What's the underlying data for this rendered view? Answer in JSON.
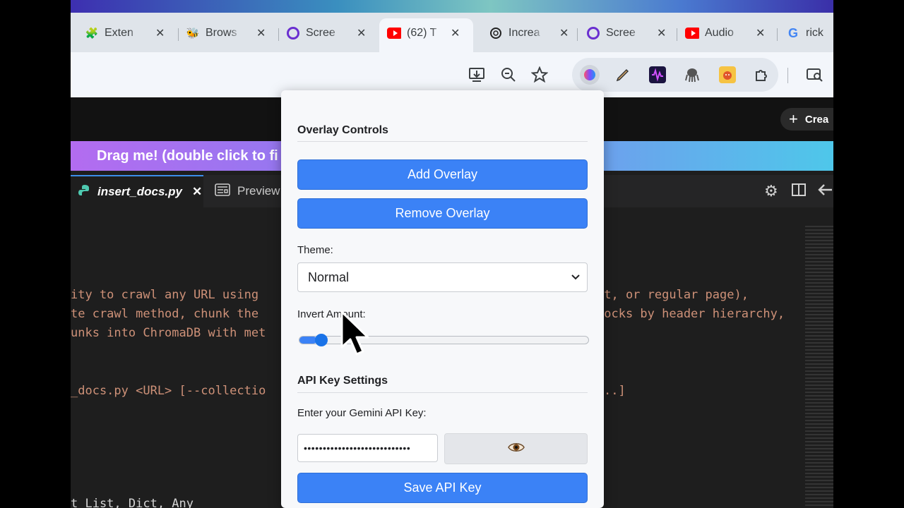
{
  "browser": {
    "tabs": [
      {
        "title": "Exten",
        "icon": "puzzle-icon"
      },
      {
        "title": "Brows",
        "icon": "bee-icon"
      },
      {
        "title": "Scree",
        "icon": "circle-icon"
      },
      {
        "title": "(62) T",
        "icon": "youtube-icon",
        "active": true
      },
      {
        "title": "Increa",
        "icon": "openai-icon"
      },
      {
        "title": "Scree",
        "icon": "circle-icon"
      },
      {
        "title": "Audio",
        "icon": "youtube-icon"
      },
      {
        "title": "rick",
        "icon": "google-icon"
      }
    ],
    "close_glyph": "✕",
    "toolbar_icons": [
      "install-icon",
      "zoom-icon",
      "bookmark-star-icon"
    ],
    "extension_icons": [
      "color-picker-icon",
      "pencil-icon",
      "waveform-icon",
      "octopus-icon",
      "dog-icon",
      "extensions-puzzle-icon"
    ],
    "side_panel_icon": "tab-search-icon"
  },
  "page": {
    "create_label": "Crea",
    "drag_banner": "Drag me! (double click to fi",
    "editor_tabs": [
      {
        "label": "insert_docs.py",
        "close": "✕"
      },
      {
        "label": "Preview"
      }
    ],
    "code_lines": [
      {
        "left": "ity to crawl any URL using",
        "right": "xt, or regular page),"
      },
      {
        "left": "te crawl method, chunk the",
        "right": "locks by header hierarchy,"
      },
      {
        "left": "unks into ChromaDB with met",
        "right": ""
      },
      {
        "left": "_docs.py <URL> [--collectio",
        "right": "..]"
      },
      {
        "left": "t List, Dict, Any",
        "right": ""
      }
    ]
  },
  "popup": {
    "overlay_title": "Overlay Controls",
    "add_overlay": "Add Overlay",
    "remove_overlay": "Remove Overlay",
    "theme_label": "Theme:",
    "theme_value": "Normal",
    "invert_label": "Invert Amount:",
    "invert_value": 0.04,
    "api_title": "API Key Settings",
    "api_label": "Enter your Gemini API Key:",
    "api_value": "••••••••••••••••••••••••••••",
    "show_key_icon": "eye-icon",
    "save_api": "Save API Key"
  },
  "colors": {
    "primary_button": "#3b82f6",
    "editor_bg": "#1e1e1e",
    "code_string": "#ce9178"
  }
}
